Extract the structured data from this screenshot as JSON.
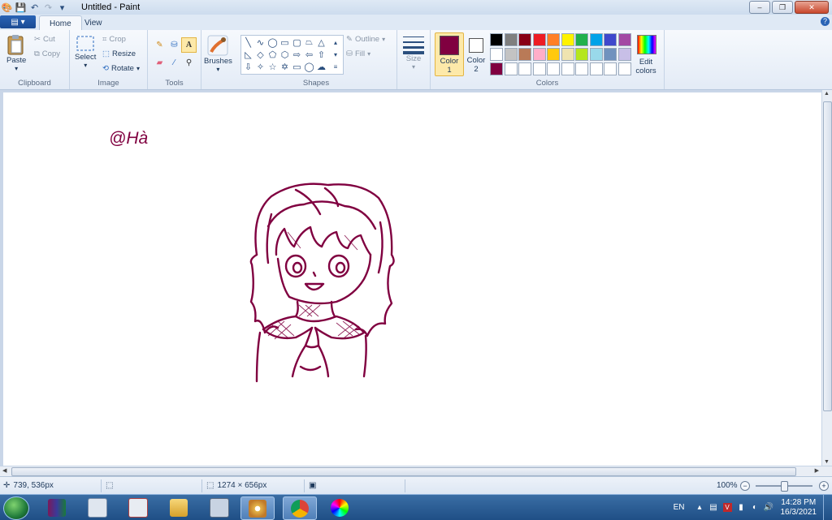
{
  "window": {
    "title": "Untitled - Paint"
  },
  "ribbon_tabs": {
    "home": "Home",
    "view": "View"
  },
  "clipboard": {
    "paste": "Paste",
    "cut": "Cut",
    "copy": "Copy",
    "label": "Clipboard"
  },
  "image": {
    "select": "Select",
    "crop": "Crop",
    "resize": "Resize",
    "rotate": "Rotate",
    "label": "Image"
  },
  "tools": {
    "label": "Tools",
    "brushes": "Brushes"
  },
  "shapes": {
    "outline": "Outline",
    "fill": "Fill",
    "label": "Shapes"
  },
  "size": {
    "label": "Size"
  },
  "colors": {
    "color1_label": "Color",
    "color1_num": "1",
    "color2_label": "Color",
    "color2_num": "2",
    "edit_label1": "Edit",
    "edit_label2": "colors",
    "label": "Colors",
    "color1": "#800040",
    "color2": "#ffffff",
    "palette_row1": [
      "#000000",
      "#7f7f7f",
      "#880015",
      "#ed1c24",
      "#ff7f27",
      "#fff200",
      "#22b14c",
      "#00a2e8",
      "#3f48cc",
      "#a349a4"
    ],
    "palette_row2": [
      "#ffffff",
      "#c3c3c3",
      "#b97a57",
      "#ffaec9",
      "#ffc90e",
      "#efe4b0",
      "#b5e61d",
      "#99d9ea",
      "#7092be",
      "#c8bfe7"
    ],
    "palette_row3": [
      "#800040",
      "#ffffff",
      "#ffffff",
      "#ffffff",
      "#ffffff",
      "#ffffff",
      "#ffffff",
      "#ffffff",
      "#ffffff",
      "#ffffff"
    ]
  },
  "canvas": {
    "signature": "@Hà",
    "ink": "#800040"
  },
  "status": {
    "cursor_pos": "739, 536px",
    "canvas_size": "1274 × 656px",
    "zoom": "100%"
  },
  "taskbar": {
    "lang": "EN",
    "time": "14:28 PM",
    "date": "16/3/2021"
  }
}
